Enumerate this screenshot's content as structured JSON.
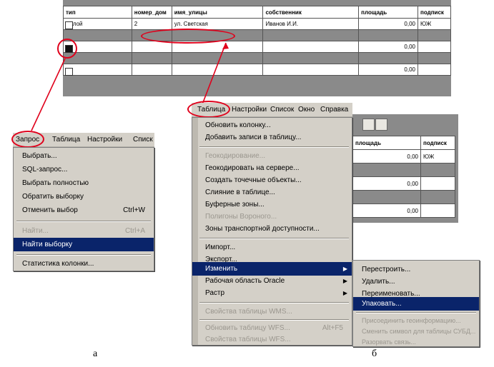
{
  "table": {
    "columns": [
      "тип",
      "номер_дом",
      "имя_улицы",
      "собственник",
      "площадь",
      "подписк"
    ],
    "rows": [
      {
        "type": "жилой",
        "house": "2",
        "street": "ул. Светская",
        "owner": "Иванов И.И.",
        "area": "0,00",
        "sub": "ЮЖ"
      },
      {
        "type": "",
        "house": "",
        "street": "",
        "owner": "",
        "area": "0,00",
        "sub": ""
      },
      {
        "type": "",
        "house": "",
        "street": "",
        "owner": "",
        "area": "0,00",
        "sub": ""
      }
    ]
  },
  "menu_a": {
    "bar": [
      "Запрос",
      "Таблица",
      "Настройки",
      "Списк"
    ],
    "items": [
      {
        "label": "Выбрать...",
        "shortcut": "",
        "state": "normal"
      },
      {
        "label": "SQL-запрос...",
        "shortcut": "",
        "state": "normal"
      },
      {
        "label": "Выбрать полностью",
        "shortcut": "",
        "state": "normal"
      },
      {
        "label": "Обратить выборку",
        "shortcut": "",
        "state": "normal"
      },
      {
        "label": "Отменить выбор",
        "shortcut": "Ctrl+W",
        "state": "normal"
      },
      {
        "label": "Найти...",
        "shortcut": "Ctrl+A",
        "state": "disabled"
      },
      {
        "label": "Найти выборку",
        "shortcut": "",
        "state": "selected"
      },
      {
        "label": "Статистика колонки...",
        "shortcut": "",
        "state": "normal"
      }
    ]
  },
  "menu_b": {
    "bar": [
      "Таблица",
      "Настройки",
      "Список",
      "Окно",
      "Справка"
    ],
    "items": [
      {
        "label": "Обновить колонку...",
        "state": "normal"
      },
      {
        "label": "Добавить записи в таблицу...",
        "state": "normal"
      },
      {
        "label": "Геокодирование...",
        "state": "disabled"
      },
      {
        "label": "Геокодировать на сервере...",
        "state": "normal"
      },
      {
        "label": "Создать точечные объекты...",
        "state": "normal"
      },
      {
        "label": "Слияние в таблице...",
        "state": "normal"
      },
      {
        "label": "Буферные зоны...",
        "state": "normal"
      },
      {
        "label": "Полигоны Вороного...",
        "state": "disabled"
      },
      {
        "label": "Зоны транспортной доступности...",
        "state": "normal"
      },
      {
        "label": "Импорт...",
        "state": "normal"
      },
      {
        "label": "Экспорт...",
        "state": "normal"
      },
      {
        "label": "Изменить",
        "state": "selected",
        "submenu": true
      },
      {
        "label": "Рабочая область Oracle",
        "state": "normal",
        "submenu": true
      },
      {
        "label": "Растр",
        "state": "normal",
        "submenu": true
      },
      {
        "label": "Свойства таблицы WMS...",
        "state": "disabled"
      },
      {
        "label": "Обновить таблицу WFS...",
        "state": "disabled",
        "shortcut": "Alt+F5"
      },
      {
        "label": "Свойства таблицы WFS...",
        "state": "disabled"
      }
    ]
  },
  "submenu": {
    "items": [
      {
        "label": "Перестроить...",
        "state": "normal"
      },
      {
        "label": "Удалить...",
        "state": "normal"
      },
      {
        "label": "Переименовать...",
        "state": "normal"
      },
      {
        "label": "Упаковать...",
        "state": "selected"
      },
      {
        "label": "Присоединить геоинформацию...",
        "state": "disabled"
      },
      {
        "label": "Сменить символ для таблицы СУБД...",
        "state": "disabled"
      },
      {
        "label": "Разорвать связь...",
        "state": "disabled"
      }
    ]
  },
  "window_b": {
    "columns": [
      "площадь",
      "подписк"
    ],
    "rows": [
      {
        "area": "0,00",
        "sub": "ЮЖ"
      },
      {
        "area": "0,00",
        "sub": ""
      },
      {
        "area": "0,00",
        "sub": ""
      }
    ]
  },
  "captions": {
    "a": "а",
    "b": "б"
  },
  "colors": {
    "highlight": "#0a246a",
    "annotation": "#e0001b",
    "menu_bg": "#d4d0c8"
  }
}
